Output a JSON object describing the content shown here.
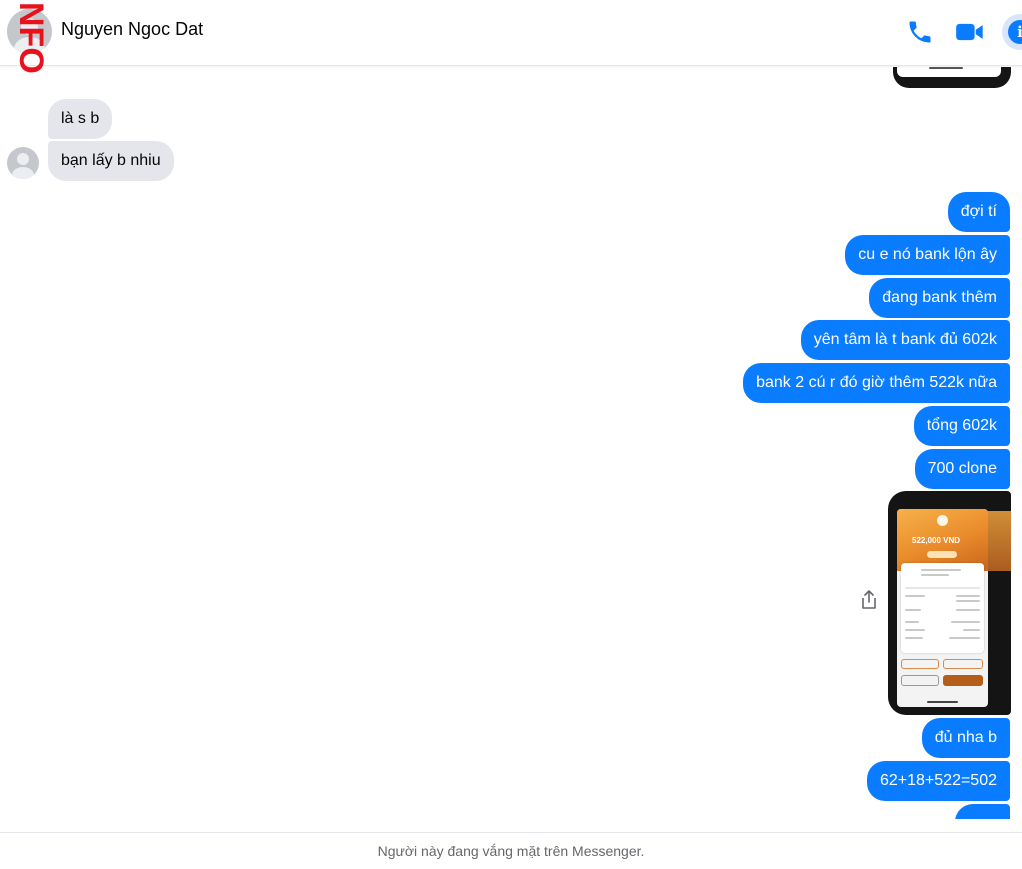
{
  "header": {
    "contact_name": "Nguyen Ngoc Dat",
    "watermark_text": "NFO",
    "call_icon": "phone-icon",
    "video_icon": "video-camera-icon",
    "info_icon": "info-icon",
    "accent_color": "#0a7cff"
  },
  "incoming_messages": [
    "là s b",
    "bạn lấy b nhiu"
  ],
  "outgoing_messages": [
    "đợi tí",
    "cu e nó bank lộn ây",
    "đang bank thêm",
    "yên tâm là t bank đủ 602k",
    "bank 2 cú r đó giờ thêm 522k nữa",
    "tổng 602k",
    "700 clone",
    "đủ nha b",
    "62+18+522=502"
  ],
  "attachment": {
    "amount_text": "522,000 VND",
    "share_icon": "share-icon"
  },
  "footer": {
    "status_text": "Người này đang vắng mặt trên Messenger."
  },
  "colors": {
    "outgoing_bubble": "#0a7cff",
    "incoming_bubble": "#e4e6eb",
    "watermark": "#e8121c"
  }
}
